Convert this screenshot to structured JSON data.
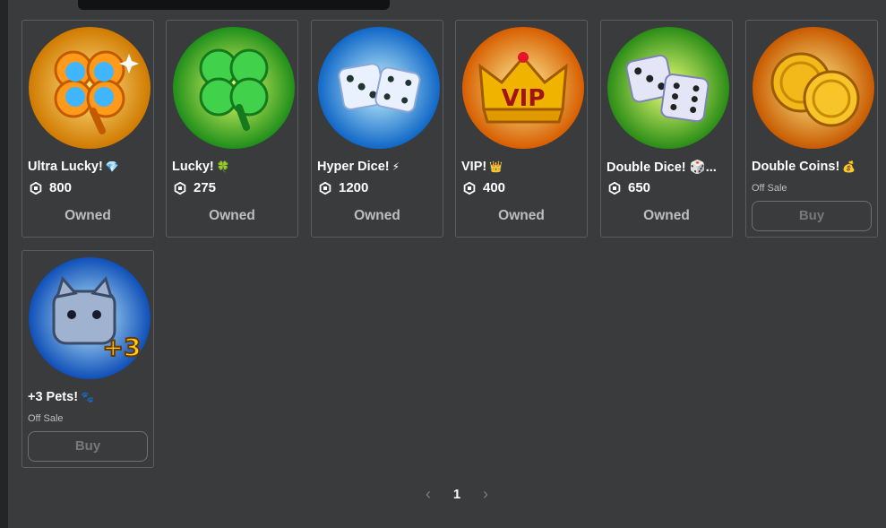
{
  "items": [
    {
      "name": "Ultra Lucky!",
      "emoji": "💎",
      "price": "800",
      "status": "Owned",
      "colors": {
        "bg1": "#ffd24a",
        "bg2": "#d07a00"
      }
    },
    {
      "name": "Lucky!",
      "emoji": "🍀",
      "price": "275",
      "status": "Owned",
      "colors": {
        "bg1": "#c8f03a",
        "bg2": "#1f8f1a"
      }
    },
    {
      "name": "Hyper Dice!",
      "emoji": "⚡",
      "price": "1200",
      "status": "Owned",
      "colors": {
        "bg1": "#8ee9ff",
        "bg2": "#1067c7"
      }
    },
    {
      "name": "VIP!",
      "emoji": "👑",
      "price": "400",
      "status": "Owned",
      "colors": {
        "bg1": "#ffe066",
        "bg2": "#d75e00"
      }
    },
    {
      "name": "Double Dice! 🎲...",
      "emoji": "",
      "price": "650",
      "status": "Owned",
      "colors": {
        "bg1": "#d4f53b",
        "bg2": "#2a8d16"
      }
    },
    {
      "name": "Double Coins!",
      "emoji": "💰",
      "off_sale": "Off Sale",
      "buy": "Buy",
      "colors": {
        "bg1": "#ffd45a",
        "bg2": "#c85a00"
      }
    },
    {
      "name": "+3 Pets!",
      "emoji": "🐾",
      "off_sale": "Off Sale",
      "buy": "Buy",
      "colors": {
        "bg1": "#8fe4ff",
        "bg2": "#0f4fb8"
      }
    }
  ],
  "pagination": {
    "prev": "‹",
    "page": "1",
    "next": "›"
  },
  "icons": {
    "robux": "robux-icon",
    "prev": "chevron-left-icon",
    "next": "chevron-right-icon"
  }
}
